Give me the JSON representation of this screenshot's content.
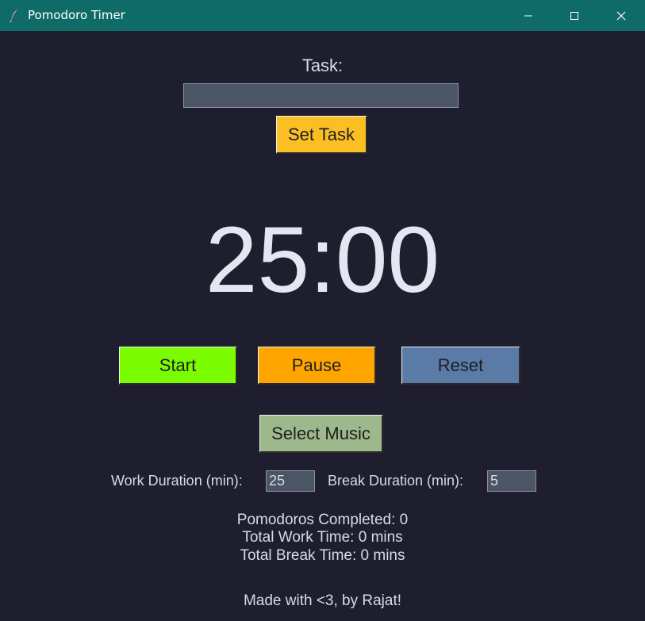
{
  "window": {
    "title": "Pomodoro Timer",
    "icon": "feather-icon",
    "controls": [
      "minimize-icon",
      "maximize-icon",
      "close-icon"
    ]
  },
  "task": {
    "label": "Task:",
    "input_value": "",
    "set_button": "Set Task"
  },
  "timer": {
    "display": "25:00"
  },
  "controls": {
    "start": "Start",
    "pause": "Pause",
    "reset": "Reset",
    "select_music": "Select Music"
  },
  "durations": {
    "work_label": "Work Duration (min):",
    "work_value": "25",
    "break_label": "Break Duration (min):",
    "break_value": "5"
  },
  "stats": {
    "pomodoros": "Pomodoros Completed: 0",
    "work_time": "Total Work Time: 0 mins",
    "break_time": "Total Break Time: 0 mins"
  },
  "footer": "Made with <3, by Rajat!",
  "colors": {
    "background": "#1e1e2e",
    "titlebar": "#0f6b68",
    "set_task": "#fbbf24",
    "start": "#7cfc00",
    "pause": "#ffa500",
    "reset": "#5a7ba6",
    "select_music": "#9db88a",
    "input": "#4c5565",
    "text": "#d6dbe8"
  }
}
